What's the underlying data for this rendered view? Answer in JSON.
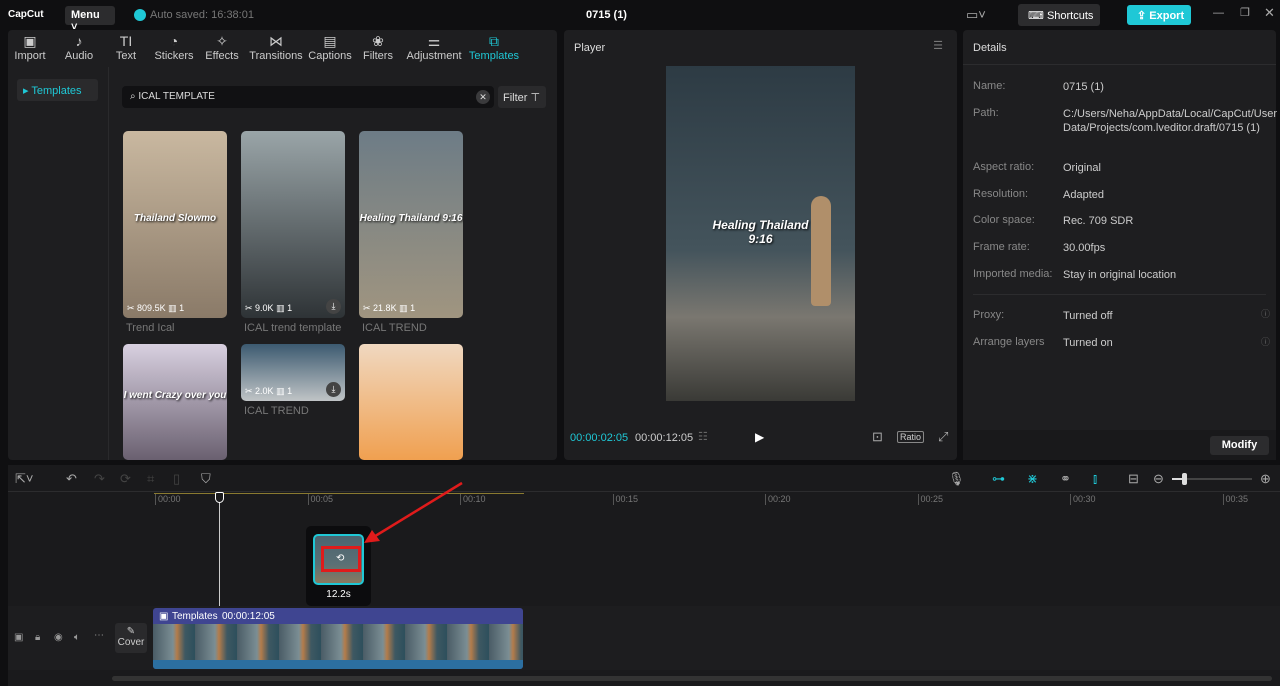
{
  "app": {
    "logo": "CapCut",
    "menu": "Menu",
    "autosave": "Auto saved: 16:38:01",
    "title": "0715 (1)",
    "shortcuts": "Shortcuts",
    "export": "Export"
  },
  "toolbar": [
    {
      "label": "Import",
      "icon": "▣"
    },
    {
      "label": "Audio",
      "icon": "♪"
    },
    {
      "label": "Text",
      "icon": "TI"
    },
    {
      "label": "Stickers",
      "icon": "◔"
    },
    {
      "label": "Effects",
      "icon": "✧"
    },
    {
      "label": "Transitions",
      "icon": "⋈"
    },
    {
      "label": "Captions",
      "icon": "▤"
    },
    {
      "label": "Filters",
      "icon": "❀"
    },
    {
      "label": "Adjustment",
      "icon": "⚌"
    },
    {
      "label": "Templates",
      "icon": "⧉"
    }
  ],
  "sidebar": {
    "item": "Templates"
  },
  "search": {
    "value": "ICAL TEMPLATE",
    "filter": "Filter"
  },
  "templates": [
    {
      "title": "Trend Ical",
      "uses": "809.5K",
      "clips": "1",
      "overlay": "Thailand Slowmo"
    },
    {
      "title": "ICAL trend template",
      "uses": "9.0K",
      "clips": "1",
      "overlay": ""
    },
    {
      "title": "ICAL TREND",
      "uses": "21.8K",
      "clips": "1",
      "overlay": "Healing Thailand 9:16"
    },
    {
      "title": "",
      "uses": "",
      "clips": "",
      "overlay": "I went Crazy over you"
    },
    {
      "title": "ICAL TREND",
      "uses": "2.0K",
      "clips": "1",
      "overlay": ""
    },
    {
      "title": "",
      "uses": "",
      "clips": "",
      "overlay": ""
    }
  ],
  "player": {
    "title": "Player",
    "overlay_line1": "Healing Thailand",
    "overlay_line2": "9:16",
    "current": "00:00:02:05",
    "total": "00:00:12:05",
    "ratio": "Ratio"
  },
  "details": {
    "title": "Details",
    "rows": [
      {
        "label": "Name:",
        "value": "0715 (1)"
      },
      {
        "label": "Path:",
        "value": "C:/Users/Neha/AppData/Local/CapCut/User Data/Projects/com.lveditor.draft/0715 (1)"
      },
      {
        "label": "Aspect ratio:",
        "value": "Original"
      },
      {
        "label": "Resolution:",
        "value": "Adapted"
      },
      {
        "label": "Color space:",
        "value": "Rec. 709 SDR"
      },
      {
        "label": "Frame rate:",
        "value": "30.00fps"
      },
      {
        "label": "Imported media:",
        "value": "Stay in original location"
      },
      {
        "label": "Proxy:",
        "value": "Turned off"
      },
      {
        "label": "Arrange layers",
        "value": "Turned on"
      }
    ],
    "modify": "Modify"
  },
  "timeline": {
    "ticks": [
      "00:00",
      "00:05",
      "00:10",
      "00:15",
      "00:20",
      "00:25",
      "00:30",
      "00:35"
    ],
    "drag_duration": "12.2s",
    "clip_label": "Templates",
    "clip_duration": "00:00:12:05",
    "cover": "Cover",
    "accent": "#1fc8d6"
  }
}
